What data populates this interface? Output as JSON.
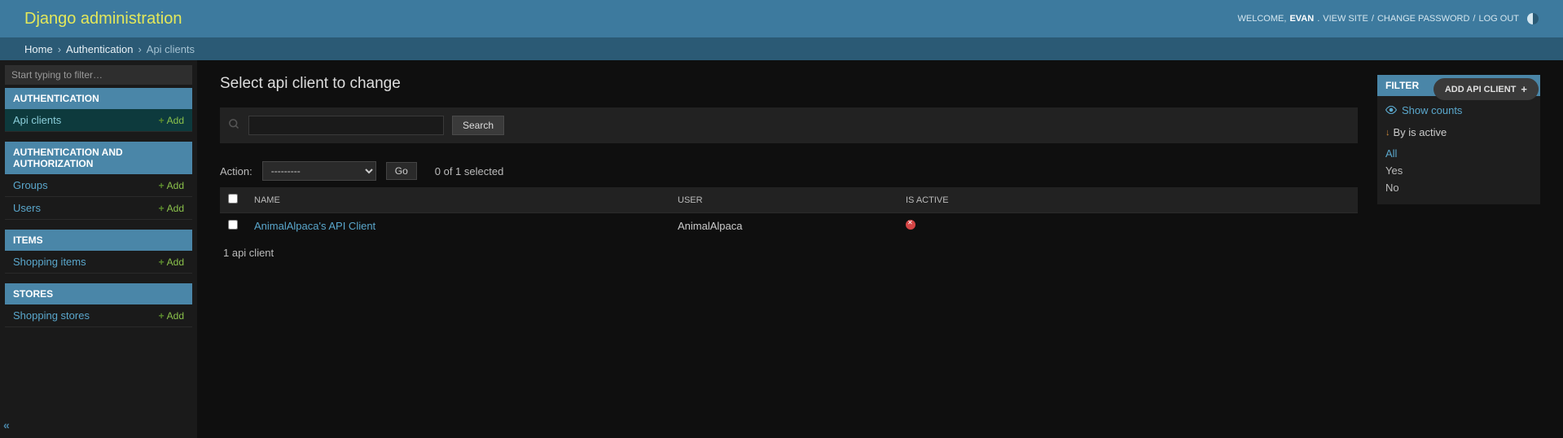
{
  "header": {
    "branding": "Django administration",
    "welcome": "WELCOME,",
    "username": "EVAN",
    "view_site": "VIEW SITE",
    "change_password": "CHANGE PASSWORD",
    "log_out": "LOG OUT"
  },
  "breadcrumbs": {
    "home": "Home",
    "app": "Authentication",
    "current": "Api clients"
  },
  "sidebar": {
    "filter_placeholder": "Start typing to filter…",
    "apps": [
      {
        "caption": "AUTHENTICATION",
        "models": [
          {
            "name": "Api clients",
            "add": "Add",
            "selected": true
          }
        ]
      },
      {
        "caption": "AUTHENTICATION AND AUTHORIZATION",
        "models": [
          {
            "name": "Groups",
            "add": "Add",
            "selected": false
          },
          {
            "name": "Users",
            "add": "Add",
            "selected": false
          }
        ]
      },
      {
        "caption": "ITEMS",
        "models": [
          {
            "name": "Shopping items",
            "add": "Add",
            "selected": false
          }
        ]
      },
      {
        "caption": "STORES",
        "models": [
          {
            "name": "Shopping stores",
            "add": "Add",
            "selected": false
          }
        ]
      }
    ]
  },
  "content": {
    "title": "Select api client to change",
    "add_button": "ADD API CLIENT",
    "search_button": "Search",
    "action_label": "Action:",
    "action_default": "---------",
    "go_button": "Go",
    "selection_count": "0 of 1 selected",
    "columns": {
      "name": "NAME",
      "user": "USER",
      "is_active": "IS ACTIVE"
    },
    "rows": [
      {
        "name": "AnimalAlpaca's API Client",
        "user": "AnimalAlpaca",
        "is_active": false
      }
    ],
    "paginator": "1 api client"
  },
  "filter": {
    "heading": "FILTER",
    "show_counts": "Show counts",
    "by_label": "By is active",
    "options": [
      "All",
      "Yes",
      "No"
    ],
    "selected": "All"
  }
}
